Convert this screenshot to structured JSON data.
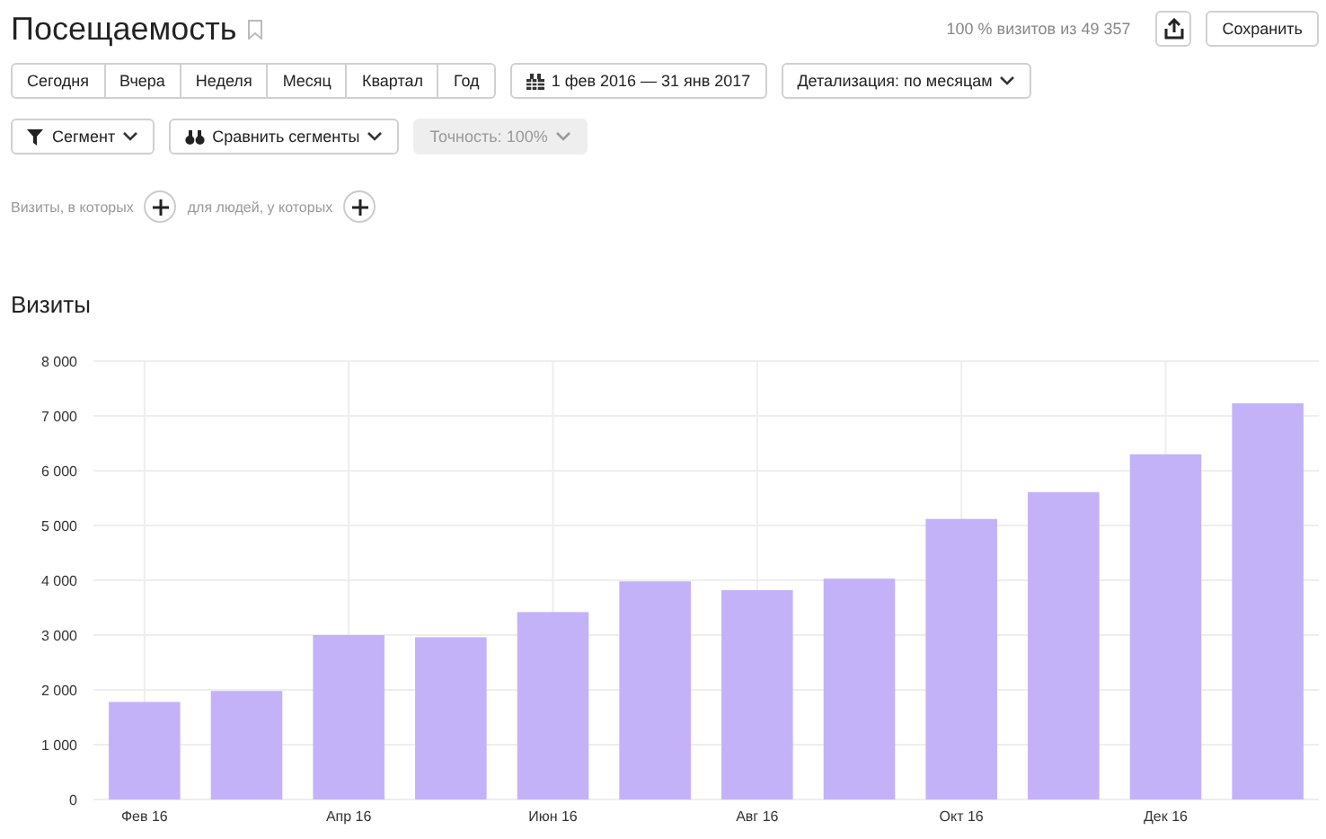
{
  "title": "Посещаемость",
  "sample_info": "100 % визитов из 49 357",
  "save_button": "Сохранить",
  "periods": [
    {
      "label": "Сегодня",
      "selected": false
    },
    {
      "label": "Вчера",
      "selected": false
    },
    {
      "label": "Неделя",
      "selected": false
    },
    {
      "label": "Месяц",
      "selected": false
    },
    {
      "label": "Квартал",
      "selected": false
    },
    {
      "label": "Год",
      "selected": false
    }
  ],
  "date_range": "1 фев 2016 — 31 янв 2017",
  "detail": "Детализация: по месяцам",
  "segment_button": "Сегмент",
  "compare_button": "Сравнить сегменты",
  "accuracy": {
    "label": "Точность: 100%",
    "disabled": true
  },
  "filters": [
    "Визиты, в которых",
    "для людей, у которых"
  ],
  "chart_title": "Визиты",
  "chart_data": {
    "type": "bar",
    "grid": true,
    "categories": [
      "Фев 16",
      null,
      "Апр 16",
      null,
      "Июн 16",
      null,
      "Авг 16",
      null,
      "Окт 16",
      null,
      "Дек 16",
      null
    ],
    "series": [
      {
        "color": "#c4b2f9",
        "values": [
          1780,
          1980,
          3000,
          2960,
          3420,
          3980,
          3820,
          4030,
          5120,
          5610,
          6300,
          7230
        ]
      }
    ],
    "ylim": [
      0,
      8000
    ],
    "yticks": [
      {
        "value": 0,
        "label": "0"
      },
      {
        "value": 1000,
        "label": "1 000"
      },
      {
        "value": 2000,
        "label": "2 000"
      },
      {
        "value": 3000,
        "label": "3 000"
      },
      {
        "value": 4000,
        "label": "4 000"
      },
      {
        "value": 5000,
        "label": "5 000"
      },
      {
        "value": 6000,
        "label": "6 000"
      },
      {
        "value": 7000,
        "label": "7 000"
      },
      {
        "value": 8000,
        "label": "8 000"
      }
    ]
  }
}
